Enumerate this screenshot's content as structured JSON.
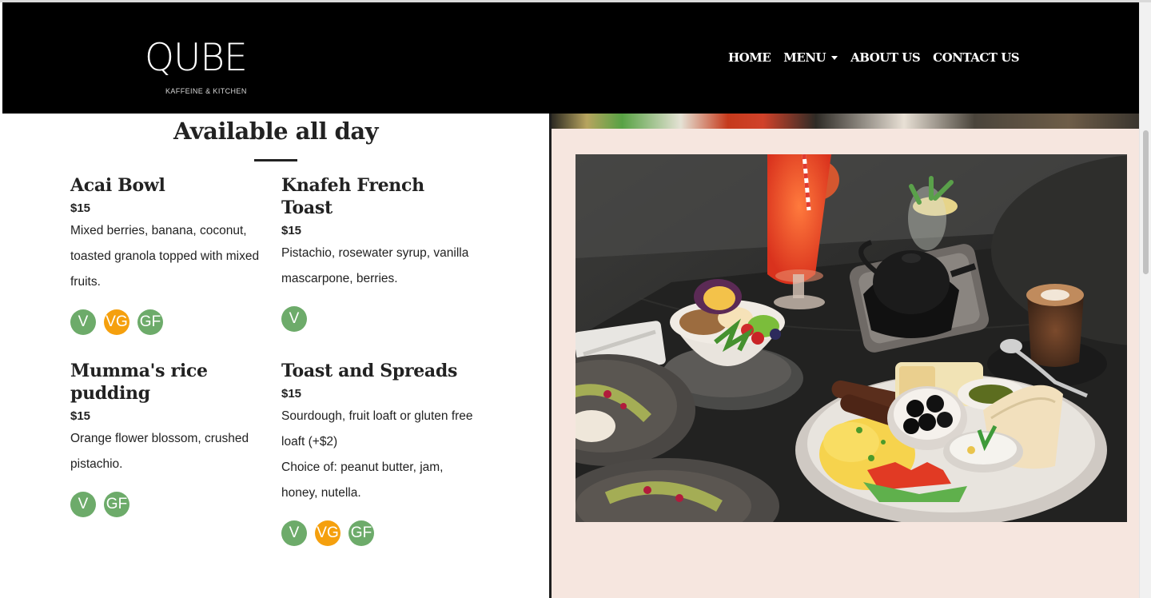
{
  "brand": {
    "logo_text": "QUBE",
    "tagline": "KAFFEINE & KITCHEN"
  },
  "nav": {
    "items": [
      {
        "label": "HOME"
      },
      {
        "label": "MENU",
        "dropdown": true
      },
      {
        "label": "ABOUT US"
      },
      {
        "label": "CONTACT US"
      }
    ]
  },
  "menu": {
    "title": "Available all day",
    "items": [
      {
        "name": "Acai Bowl",
        "price": "$15",
        "desc": "Mixed berries, banana, coconut, toasted granola topped with mixed fruits.",
        "badges": [
          "V",
          "VG",
          "GF"
        ]
      },
      {
        "name": "Knafeh French Toast",
        "price": "$15",
        "desc": "Pistachio, rosewater syrup, vanilla mascarpone, berries.",
        "badges": [
          "V"
        ]
      },
      {
        "name": "Mumma's rice pudding",
        "price": "$15",
        "desc": "Orange flower blossom, crushed pistachio.",
        "badges": [
          "V",
          "GF"
        ]
      },
      {
        "name": "Toast and Spreads",
        "price": "$15",
        "desc": "Sourdough, fruit loaft or gluten free loaft (+$2)",
        "desc2": "Choice of: peanut butter, jam, honey, nutella.",
        "badges": [
          "V",
          "VG",
          "GF"
        ]
      }
    ]
  },
  "colors": {
    "header_bg": "#000000",
    "badge_green": "#6dab6a",
    "badge_orange": "#f5a00e",
    "panel_bg": "#f6e6df"
  }
}
